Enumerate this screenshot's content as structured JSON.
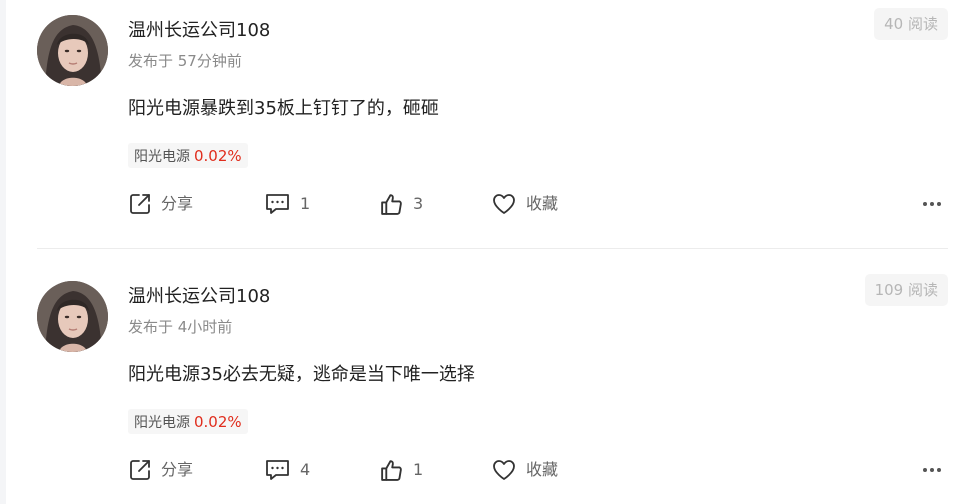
{
  "colors": {
    "stock_change": "#e02d1d",
    "text_primary": "#222222",
    "text_secondary": "#8a8a8a",
    "divider": "#ececec"
  },
  "posts": [
    {
      "author": "温州长运公司108",
      "publish_time": "发布于 57分钟前",
      "read_count": "40 阅读",
      "content": "阳光电源暴跌到35板上钉钉了的，砸砸",
      "stock_tag": {
        "name": "阳光电源",
        "change": "0.02%"
      },
      "actions": {
        "share": "分享",
        "comments": "1",
        "likes": "3",
        "favorite": "收藏"
      },
      "icons": [
        "share-icon",
        "comment-icon",
        "thumbs-up-icon",
        "heart-icon",
        "more-icon"
      ]
    },
    {
      "author": "温州长运公司108",
      "publish_time": "发布于 4小时前",
      "read_count": "109 阅读",
      "content": "阳光电源35必去无疑，逃命是当下唯一选择",
      "stock_tag": {
        "name": "阳光电源",
        "change": "0.02%"
      },
      "actions": {
        "share": "分享",
        "comments": "4",
        "likes": "1",
        "favorite": "收藏"
      },
      "icons": [
        "share-icon",
        "comment-icon",
        "thumbs-up-icon",
        "heart-icon",
        "more-icon"
      ]
    }
  ]
}
